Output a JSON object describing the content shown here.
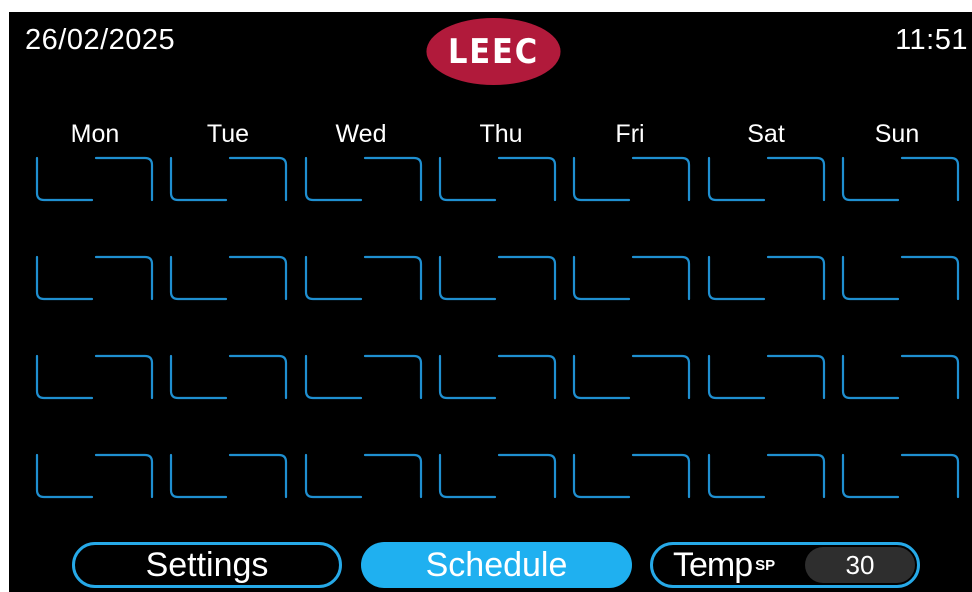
{
  "header": {
    "date": "26/02/2025",
    "time": "11:51",
    "logo_text": "LEEC"
  },
  "schedule": {
    "days": [
      "Mon",
      "Tue",
      "Wed",
      "Thu",
      "Fri",
      "Sat",
      "Sun"
    ],
    "rows": 4,
    "slot_color": "#1f8fd0"
  },
  "footer": {
    "settings_label": "Settings",
    "schedule_label": "Schedule",
    "temp_label": "Temp",
    "temp_superscript": "SP",
    "temp_value": "30"
  },
  "colors": {
    "background": "#000000",
    "accent": "#1fb0f0",
    "logo": "#b11a3b"
  }
}
